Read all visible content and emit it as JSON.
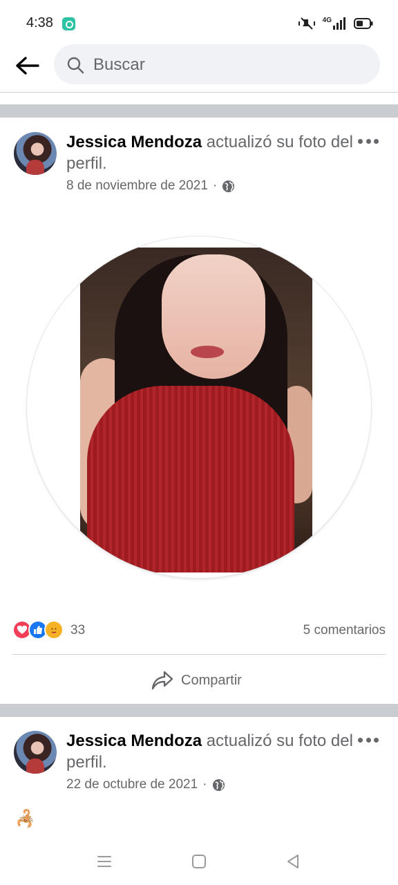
{
  "status_bar": {
    "time": "4:38",
    "network": "4G",
    "icons": [
      "app-notification-icon",
      "mute-icon",
      "signal-icon",
      "battery-icon"
    ]
  },
  "search": {
    "placeholder": "Buscar",
    "back_icon": "arrow-left-icon"
  },
  "posts": [
    {
      "author": "Jessica Mendoza",
      "action": "actualizó su foto del perfil.",
      "date": "8 de noviembre de 2021",
      "separator": "·",
      "privacy_icon": "globe-icon",
      "reactions": [
        "love",
        "like",
        "care"
      ],
      "reaction_count": "33",
      "comments": "5 comentarios",
      "share_label": "Compartir"
    },
    {
      "author": "Jessica Mendoza",
      "action": "actualizó su foto del perfil.",
      "date": "22 de octubre de 2021",
      "separator": "·",
      "privacy_icon": "globe-icon",
      "caption_emoji": "🦂"
    }
  ],
  "colors": {
    "text_primary": "#050505",
    "text_secondary": "#65676b",
    "divider_band": "#c9ccd1",
    "like_blue": "#1877f2",
    "love_red": "#f33e58",
    "care_yellow": "#f7b125"
  },
  "nav": {
    "icons": [
      "recent-apps-icon",
      "home-icon",
      "back-triangle-icon"
    ]
  }
}
